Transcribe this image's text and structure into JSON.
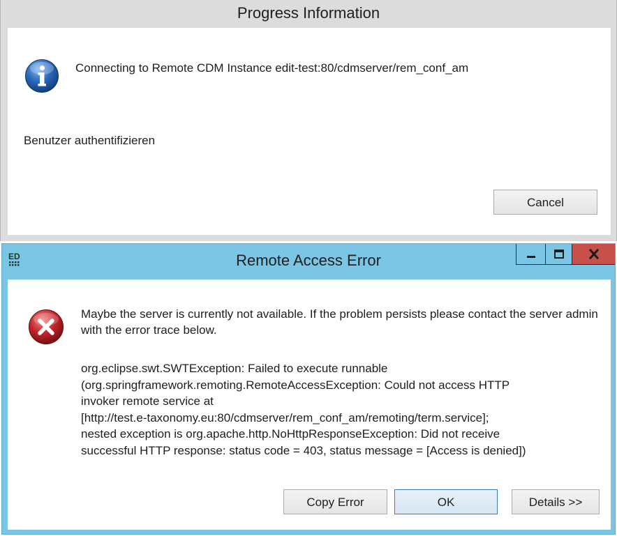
{
  "progress_dialog": {
    "title": "Progress Information",
    "message": "Connecting to Remote CDM Instance edit-test:80/cdmserver/rem_conf_am",
    "task": "Benutzer authentifizieren",
    "cancel_label": "Cancel",
    "icon": "info-icon"
  },
  "error_dialog": {
    "title": "Remote Access Error",
    "logo_text": "ED",
    "message": "Maybe the server is currently not available. If the problem persists please contact the server admin with the error trace below.",
    "trace_lines": [
      " org.eclipse.swt.SWTException: Failed to execute runnable",
      "(org.springframework.remoting.RemoteAccessException: Could not access HTTP",
      "invoker remote service at",
      "[http://test.e-taxonomy.eu:80/cdmserver/rem_conf_am/remoting/term.service];",
      "nested exception is org.apache.http.NoHttpResponseException: Did not receive",
      "successful HTTP response: status code = 403, status message = [Access is denied])"
    ],
    "buttons": {
      "copy_error": "Copy Error",
      "ok": "OK",
      "details": "Details >>"
    },
    "window_controls": {
      "minimize": "minimize-icon",
      "maximize": "maximize-icon",
      "close": "close-icon"
    },
    "icon": "error-icon"
  },
  "colors": {
    "titlebar_active": "#7ac6e4",
    "titlebar_inactive": "#dcdcdc",
    "close_button": "#c7504a",
    "info_icon": "#2a66b8",
    "error_icon": "#c2262b"
  }
}
